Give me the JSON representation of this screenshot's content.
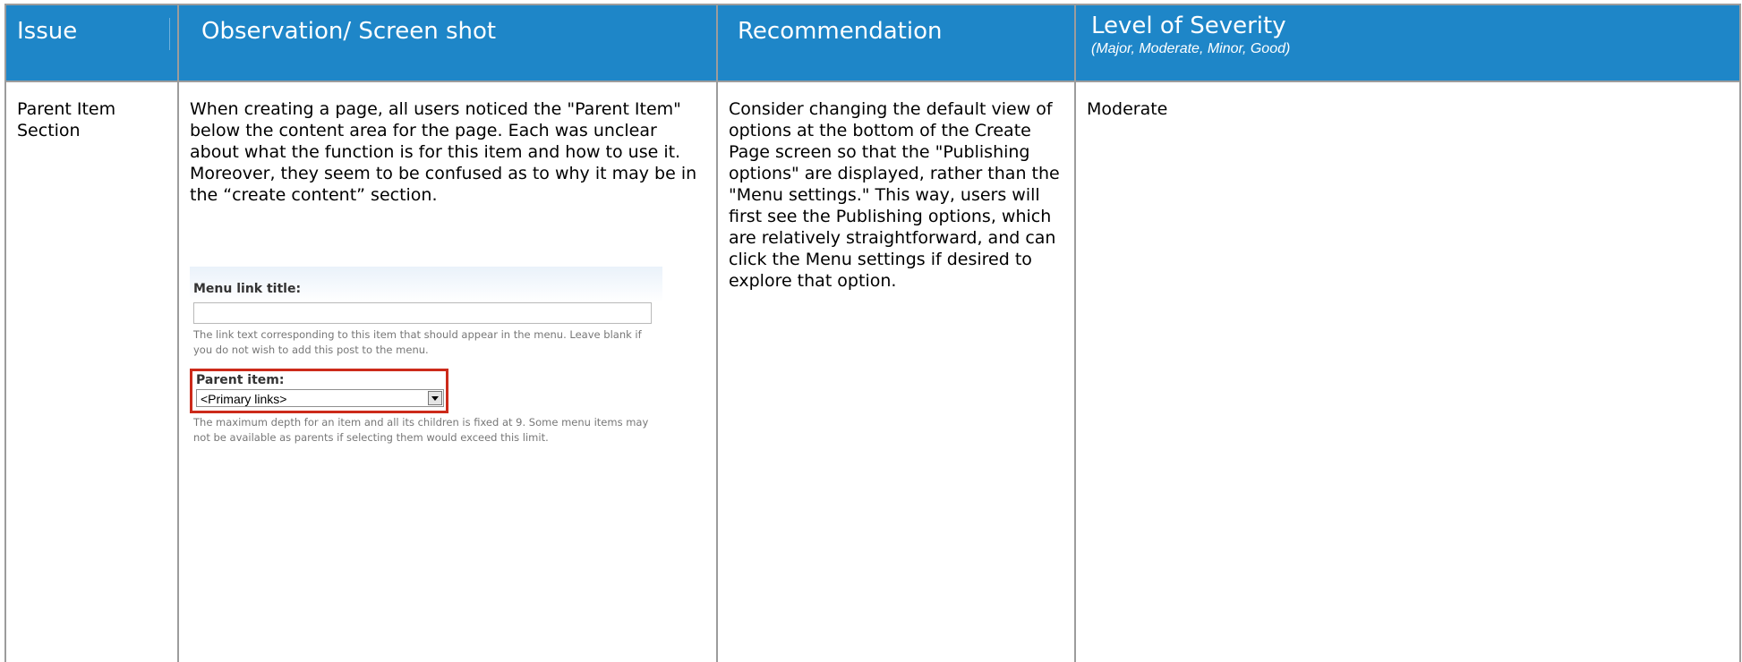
{
  "headers": {
    "issue": "Issue",
    "observation": "Observation/ Screen shot",
    "recommendation": "Recommendation",
    "severity": "Level of Severity",
    "severity_scale": "(Major, Moderate, Minor, Good)"
  },
  "row": {
    "issue": "Parent Item Section",
    "observation": "When creating a page, all users noticed the \"Parent Item\" below the content area for the page.  Each was unclear about what the function is for this item and how to use it.  Moreover, they seem to be confused as to why it may be in the “create content” section.",
    "recommendation": "Consider changing the default view of options at the bottom of the Create Page screen so that the \"Publishing options\" are displayed, rather than the \"Menu settings.\"  This way, users will first see the Publishing options, which are relatively straightforward, and can click the Menu settings if desired to explore that option.",
    "severity": "Moderate"
  },
  "screenshot": {
    "menu_link_title_label": "Menu link title:",
    "menu_link_title_value": "",
    "menu_link_help": "The link text corresponding to this item that should appear in the menu. Leave blank if you do not wish to add this post to the menu.",
    "parent_item_label": "Parent item:",
    "parent_item_value": "<Primary links>",
    "parent_item_help": "The maximum depth for an item and all its children is fixed at 9. Some menu items may not be available as parents if selecting them would exceed this limit.",
    "highlight_color": "#cc2a1a"
  },
  "colors": {
    "header_bg": "#1e86c8",
    "header_text": "#ffffff",
    "grid_line": "#9c9c9c"
  }
}
